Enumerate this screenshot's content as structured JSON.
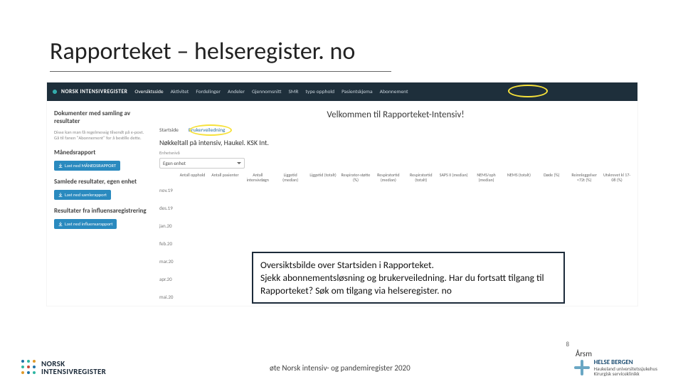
{
  "slide": {
    "title": "Rapporteket – helseregister. no"
  },
  "navbar": {
    "brand": "NORSK INTENSIVREGISTER",
    "items": [
      "Oversiktsside",
      "Aktivitet",
      "Fordelinger",
      "Andeler",
      "Gjennomsnitt",
      "SMR",
      "type opphold",
      "Pasientskjema",
      "Abonnement"
    ]
  },
  "welcome": "Velkommen til Rapporteket-Intensiv!",
  "tabs": {
    "start": "Startside",
    "guide": "Brukerveiledning"
  },
  "left": {
    "docs_h": "Dokumenter med samling av resultater",
    "docs_sub": "Disse kan man få regelmessig tilsendt på e-post. Gå til fanen \"Abonnement\" for å bestille dette.",
    "month_h": "Månedsrapport",
    "month_btn": "Last ned MÅNEDSRAPPORT",
    "saml_h": "Samlede resultater, egen enhet",
    "saml_btn": "Last ned samlerapport",
    "infl_h": "Resultater fra influensaregistrering",
    "infl_btn": "Last ned influensarapport"
  },
  "right": {
    "nokkel": "Nøkkeltall på intensiv, Haukel. KSK Int.",
    "enhet_label": "Enhetsnivå",
    "select_value": "Egen enhet",
    "columns": [
      "Antall opphold",
      "Antall pasienter",
      "Antall intensivdøgn",
      "Liggetid (median)",
      "Liggetid (totalt)",
      "Respirator-støtte (%)",
      "Respiratortid (median)",
      "Respiratortid (totalt)",
      "SAPS II (median)",
      "NEMS/oph (median)",
      "NEMS (totalt)",
      "Døde (%)",
      "Reinnleggelser <72t (%)",
      "Utskrevet kl 17-08 (%)"
    ],
    "months": [
      "nov.19",
      "des.19",
      "jan.20",
      "feb.20",
      "mar.20",
      "apr.20",
      "mai.20"
    ]
  },
  "callout": {
    "line1": "Oversiktsbilde over Startsiden i Rapporteket.",
    "line2": "Sjekk abonnementsløsning og brukerveiledning. Har du fortsatt tilgang til Rapporteket? Søk om tilgang via helseregister. no"
  },
  "footer": {
    "left_logo": "NORSK INTENSIVREGISTER",
    "center": "øte Norsk intensiv- og pandemiregister 2020",
    "right_line1": "HELSE BERGEN",
    "right_line2": "Haukeland universitetssjukehus",
    "right_line3": "Kirurgisk serviceklinikk",
    "arsm": "Årsm",
    "page": "8"
  },
  "colors": {
    "dot_blue": "#1f73a7",
    "dot_teal": "#2fb6a3",
    "dot_orange": "#e09a2b",
    "dot_red": "#c94a3b"
  }
}
